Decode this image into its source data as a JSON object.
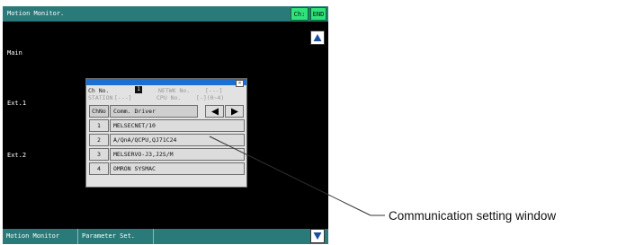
{
  "screen": {
    "title": "Motion Monitor.",
    "ch_button": "Ch:",
    "end_button": "END",
    "side_labels": [
      "Main",
      "Ext.1",
      "Ext.2"
    ],
    "bottom_tabs": [
      "Motion Monitor",
      "Parameter Set."
    ]
  },
  "dialog": {
    "ch_no_label": "Ch No.",
    "ch_no_value": "1",
    "network_label": "NETWK No.",
    "network_value": "[---]",
    "station_label": "STATION",
    "station_value": "[---]",
    "cpu_no_label": "CPU No.",
    "cpu_no_value": "[-](0~4)",
    "columns": [
      "ChNo",
      "Comm. Driver"
    ],
    "rows": [
      {
        "no": "1",
        "driver": "MELSECNET/10"
      },
      {
        "no": "2",
        "driver": "A/QnA/QCPU,QJ71C24"
      },
      {
        "no": "3",
        "driver": "MELSERVO-J3,J2S/M"
      },
      {
        "no": "4",
        "driver": "OMRON SYSMAC"
      }
    ],
    "close_glyph": "×"
  },
  "annotation": {
    "label": "Communication setting window"
  },
  "colors": {
    "screen_bg": "#000000",
    "bar": "#2a7a79",
    "button_green": "#2fe27a",
    "dialog_title": "#1c6fd0",
    "dialog_bg": "#e2e2e2"
  }
}
